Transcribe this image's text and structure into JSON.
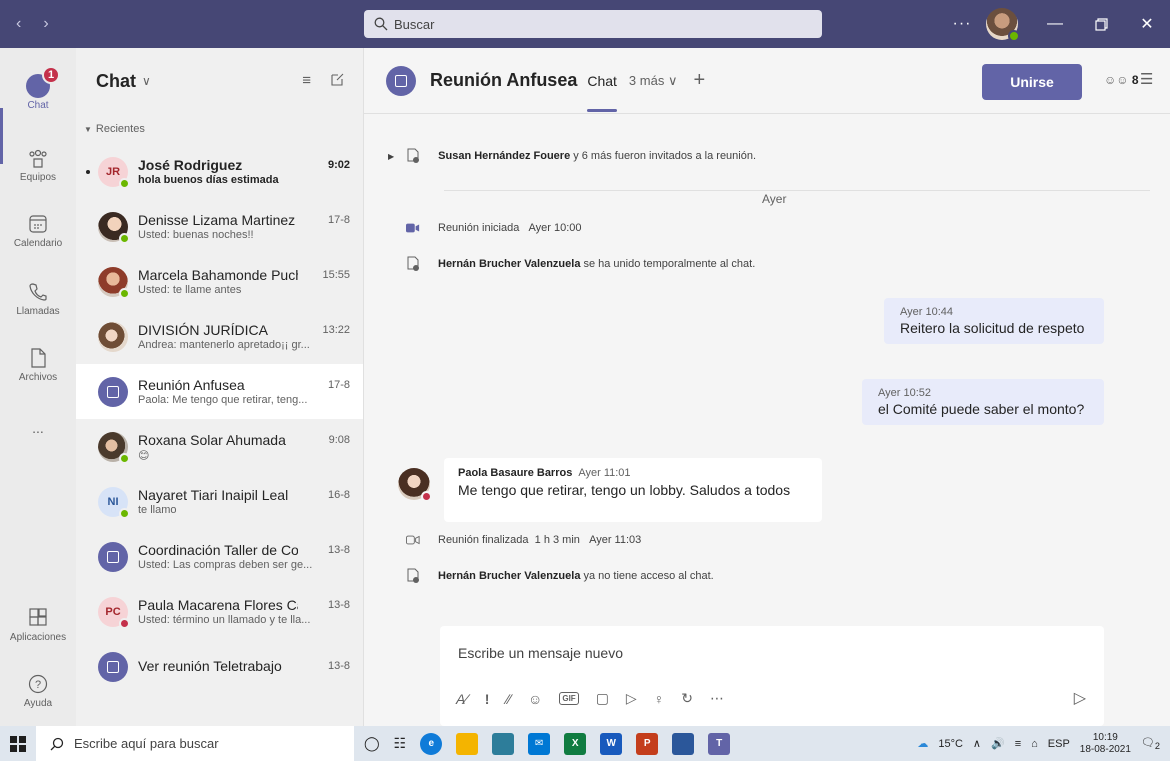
{
  "search": {
    "placeholder": "Buscar"
  },
  "rail": {
    "badge": "1",
    "items": [
      {
        "label": "Chat"
      },
      {
        "label": "Equipos"
      },
      {
        "label": "Calendario"
      },
      {
        "label": "Llamadas"
      },
      {
        "label": "Archivos"
      },
      {
        "label": "..."
      },
      {
        "label": "Aplicaciones"
      },
      {
        "label": "Ayuda"
      }
    ]
  },
  "chatlist": {
    "title": "Chat",
    "section": "Recientes",
    "items": [
      {
        "name": "José Rodriguez",
        "time": "9:02",
        "preview": "hola buenos días estimada",
        "initials": "JR"
      },
      {
        "name": "Denisse Lizama Martinez",
        "time": "17-8",
        "preview": "Usted: buenas noches!!"
      },
      {
        "name": "Marcela Bahamonde Puchi",
        "time": "15:55",
        "preview": "Usted: te llame antes"
      },
      {
        "name": "DIVISIÓN JURÍDICA",
        "time": "13:22",
        "preview": "Andrea: mantenerlo apretado¡¡ gr..."
      },
      {
        "name": "Reunión Anfusea",
        "time": "17-8",
        "preview": "Paola: Me tengo que retirar, teng..."
      },
      {
        "name": "Roxana Solar Ahumada",
        "time": "9:08",
        "preview": "😊"
      },
      {
        "name": "Nayaret Tiari Inaipil Leal",
        "time": "16-8",
        "preview": "te llamo",
        "initials": "NI"
      },
      {
        "name": "Coordinación Taller de Co...",
        "time": "13-8",
        "preview": "Usted: Las compras deben ser ge..."
      },
      {
        "name": "Paula Macarena Flores Cano",
        "time": "13-8",
        "preview": "Usted: término un llamado y te lla...",
        "initials": "PC"
      },
      {
        "name": "Ver reunión Teletrabajo",
        "time": "13-8",
        "preview": ""
      }
    ]
  },
  "main": {
    "title": "Reunión Anfusea",
    "tab_chat": "Chat",
    "tab_more": "3 más",
    "join": "Unirse",
    "participants": "8",
    "events": {
      "invited_name": "Susan Hernández Fouere",
      "invited_text": "y 6 más fueron invitados a la reunión.",
      "divider": "Ayer",
      "started": "Reunión iniciada",
      "started_time": "Ayer 10:00",
      "joined_name": "Hernán Brucher Valenzuela",
      "joined_text": "se ha unido temporalmente al chat.",
      "ended": "Reunión finalizada",
      "ended_duration": "1 h 3 min",
      "ended_time": "Ayer 11:03",
      "left_name": "Hernán Brucher Valenzuela",
      "left_text": "ya no tiene acceso al chat."
    },
    "messages": [
      {
        "time": "Ayer 10:44",
        "text": "Reitero la solicitud de respeto"
      },
      {
        "time": "Ayer 10:52",
        "text": "el Comité puede saber el monto?"
      },
      {
        "author": "Paola Basaure Barros",
        "time": "Ayer 11:01",
        "text": "Me tengo que retirar, tengo un lobby. Saludos a todos"
      }
    ],
    "composer_placeholder": "Escribe un mensaje nuevo"
  },
  "taskbar": {
    "search": "Escribe aquí para buscar",
    "weather": "15°C",
    "lang": "ESP",
    "time": "10:19",
    "date": "18-08-2021",
    "notif": "2"
  },
  "colors": {
    "accent": "#6264a7",
    "titlebar": "#464775",
    "online": "#6bb700",
    "busy": "#c4314b"
  }
}
